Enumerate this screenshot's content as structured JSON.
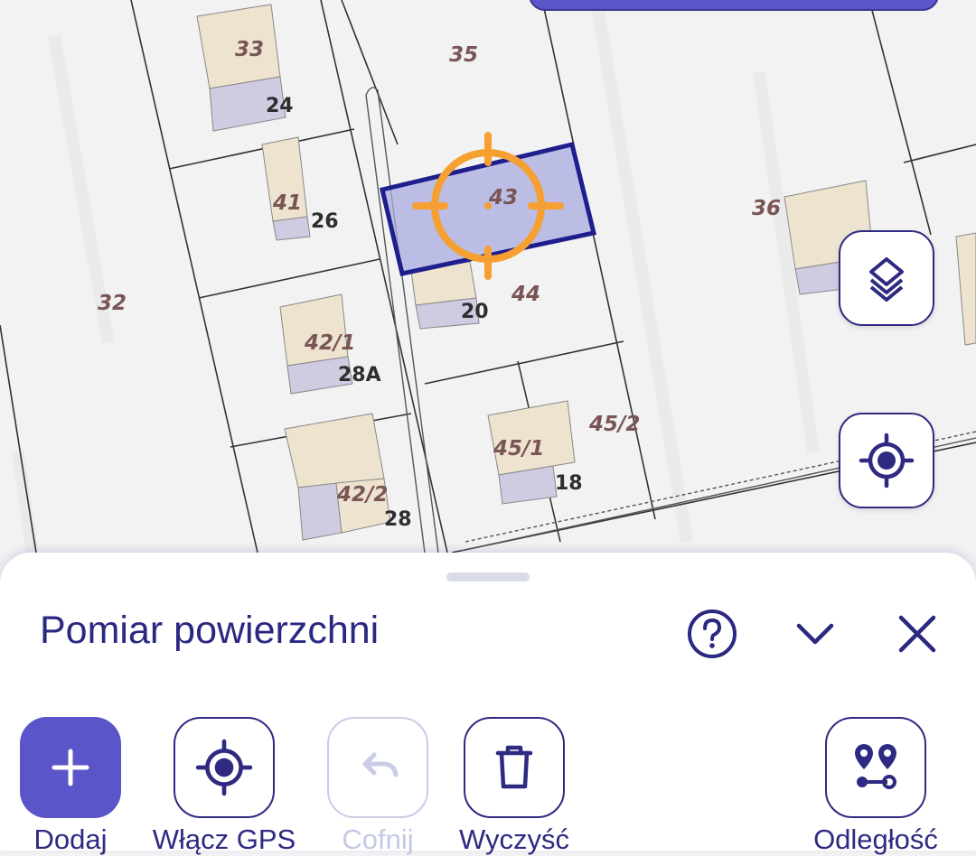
{
  "map": {
    "parcel_labels": [
      "33",
      "35",
      "41",
      "32",
      "42/1",
      "42/2",
      "43",
      "44",
      "45/1",
      "45/2",
      "36"
    ],
    "house_numbers": [
      "24",
      "26",
      "28A",
      "28",
      "20",
      "18"
    ],
    "selected_parcel": "43"
  },
  "map_controls": {
    "layers_icon": "layers-icon",
    "locate_icon": "locate-icon"
  },
  "panel": {
    "title": "Pomiar powierzchni",
    "help_icon": "help-circle-icon",
    "collapse_icon": "chevron-down-icon",
    "close_icon": "close-icon"
  },
  "toolbar": {
    "add_label": "Dodaj",
    "gps_label": "Włącz GPS",
    "undo_label": "Cofnij",
    "clear_label": "Wyczyść",
    "distance_label": "Odległość"
  },
  "colors": {
    "accent": "#5a55c8",
    "dark_blue": "#2e2a82",
    "crosshair": "#f5a030",
    "selection_fill": "#a9abe0",
    "selection_stroke": "#1e1e8c"
  }
}
